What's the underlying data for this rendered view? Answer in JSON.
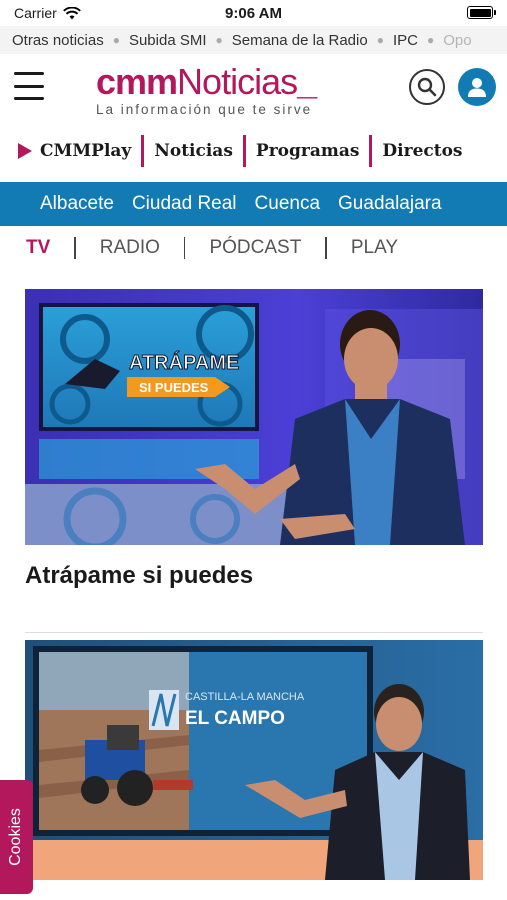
{
  "status_bar": {
    "carrier": "Carrier",
    "time": "9:06 AM"
  },
  "trending": [
    "Otras noticias",
    "Subida SMI",
    "Semana de la Radio",
    "IPC",
    "Opo"
  ],
  "header": {
    "logo_cmm": "cmm",
    "logo_noticias": "Noticias",
    "logo_underscore": "_",
    "tagline": "La información que te sirve"
  },
  "section_nav": [
    "CMMPlay",
    "Noticias",
    "Programas",
    "Directos"
  ],
  "regions": [
    "Albacete",
    "Ciudad Real",
    "Cuenca",
    "Guadalajara"
  ],
  "media_tabs": [
    "TV",
    "RADIO",
    "PÓDCAST",
    "PLAY"
  ],
  "cards": [
    {
      "title": "Atrápame si puedes",
      "screen_text_1": "ATRÁPAME",
      "screen_text_2": "SI PUEDES"
    },
    {
      "title": "",
      "screen_text_1": "CASTILLA-LA MANCHA",
      "screen_text_2": "EL CAMPO"
    }
  ],
  "cookies_label": "Cookies",
  "colors": {
    "brand": "#b4185c",
    "blue": "#127bb4"
  }
}
